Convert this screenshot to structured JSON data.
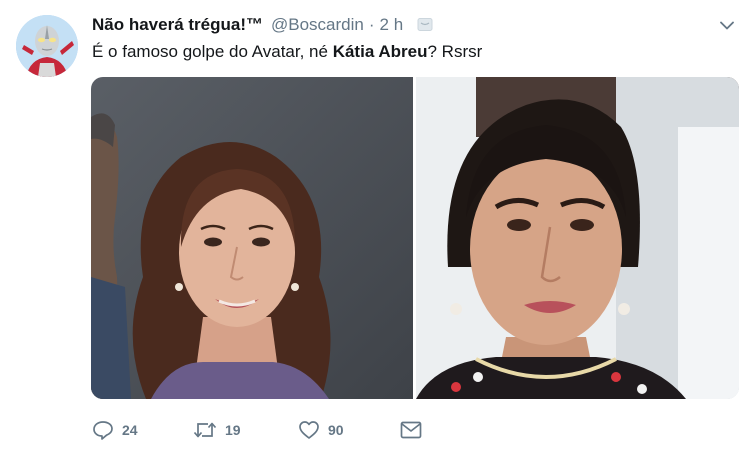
{
  "tweet": {
    "display_name": "Não haverá trégua!™",
    "handle": "@Boscardin",
    "separator": "·",
    "timestamp": "2 h",
    "text_before": "É o famoso golpe do Avatar, né ",
    "mention": "Kátia Abreu",
    "text_after": "? Rsrsr"
  },
  "actions": {
    "reply_count": "24",
    "retweet_count": "19",
    "like_count": "90"
  },
  "icons": {
    "avatar": "ultraman-avatar",
    "notification": "notification-icon",
    "menu": "chevron-down-icon",
    "reply": "reply-icon",
    "retweet": "retweet-icon",
    "like": "heart-icon",
    "message": "direct-message-icon"
  },
  "colors": {
    "text": "#14171a",
    "secondary": "#657786",
    "background": "#ffffff"
  }
}
